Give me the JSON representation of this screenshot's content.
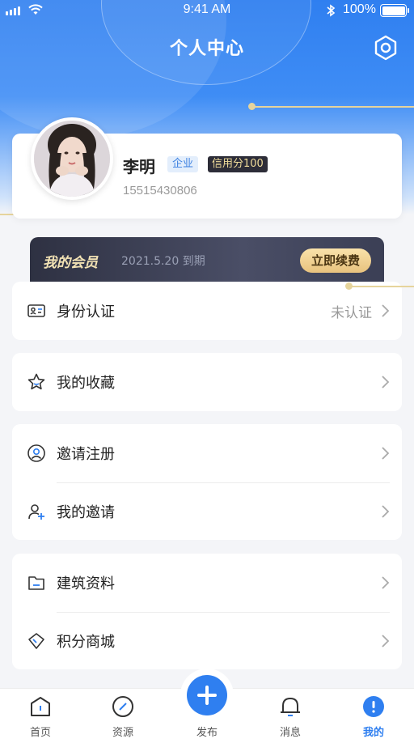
{
  "status_bar": {
    "time": "9:41 AM",
    "battery": "100%"
  },
  "header": {
    "title": "个人中心"
  },
  "profile": {
    "name": "李明",
    "company_badge": "企业",
    "credit_badge": "信用分100",
    "phone": "15515430806"
  },
  "membership": {
    "title": "我的会员",
    "expiry": "2021.5.20 到期",
    "renew_label": "立即续费"
  },
  "menu": {
    "identity": {
      "label": "身份认证",
      "value": "未认证",
      "icon": "id-card-icon"
    },
    "favorites": {
      "label": "我的收藏",
      "icon": "star-icon"
    },
    "invite_register": {
      "label": "邀请注册",
      "icon": "user-circle-icon"
    },
    "my_invites": {
      "label": "我的邀请",
      "icon": "user-plus-icon"
    },
    "building_docs": {
      "label": "建筑资料",
      "icon": "folder-icon"
    },
    "points_mall": {
      "label": "积分商城",
      "icon": "diamond-icon"
    }
  },
  "tabs": [
    {
      "label": "首页",
      "icon": "home-icon"
    },
    {
      "label": "资源",
      "icon": "compass-icon"
    },
    {
      "label": "发布",
      "icon": "plus-icon"
    },
    {
      "label": "消息",
      "icon": "bell-icon"
    },
    {
      "label": "我的",
      "icon": "user-icon",
      "active": true
    }
  ],
  "colors": {
    "primary": "#2f7ff0",
    "gold": "#e6d49c",
    "background": "#f4f5f8"
  }
}
